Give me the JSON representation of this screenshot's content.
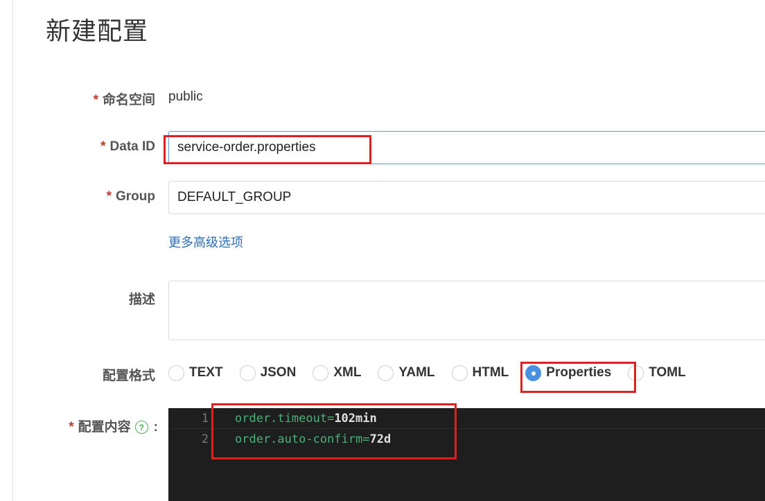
{
  "page": {
    "title": "新建配置"
  },
  "form": {
    "required_mark": "*",
    "namespace": {
      "label": "命名空间",
      "value": "public"
    },
    "data_id": {
      "label": "Data ID",
      "value": "service-order.properties"
    },
    "group": {
      "label": "Group",
      "value": "DEFAULT_GROUP"
    },
    "advanced_link": "更多高级选项",
    "description": {
      "label": "描述",
      "value": ""
    },
    "format": {
      "label": "配置格式",
      "options": [
        "TEXT",
        "JSON",
        "XML",
        "YAML",
        "HTML",
        "Properties",
        "TOML"
      ],
      "selected": "Properties"
    },
    "content": {
      "label": "配置内容",
      "help_icon": "?",
      "colon": ":",
      "lines": [
        {
          "number": "1",
          "key": "order.timeout",
          "eq": "=",
          "value": "102min"
        },
        {
          "number": "2",
          "key": "order.auto-confirm",
          "eq": "=",
          "value": "72d"
        }
      ]
    }
  },
  "colors": {
    "required": "#c0392b",
    "link": "#2e6db4",
    "radio_selected": "#4a90e2",
    "highlight": "#e02020",
    "editor_bg": "#1e1e1e"
  }
}
